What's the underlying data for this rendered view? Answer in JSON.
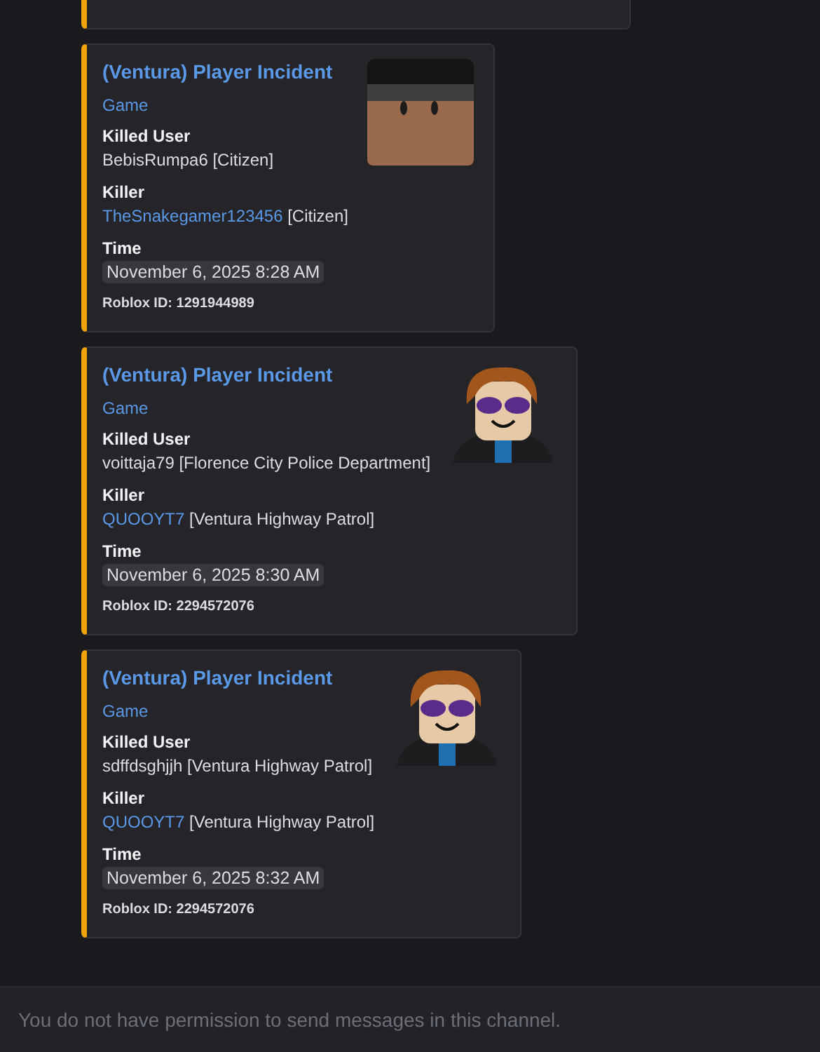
{
  "messages": [
    {
      "kind": "partial"
    },
    {
      "kind": "embed",
      "title": "(Ventura) Player Incident",
      "author": "Game",
      "thumbnail": {
        "kind": "hat"
      },
      "fields": [
        {
          "name": "Killed User",
          "kind": "text",
          "value": "BebisRumpa6 [Citizen]"
        },
        {
          "name": "Killer",
          "kind": "link",
          "link": "TheSnakegamer123456",
          "value": "[Citizen]"
        },
        {
          "name": "Time",
          "kind": "timestamp",
          "value": "November 6, 2025 8:28 AM"
        }
      ],
      "footer": "Roblox ID: 1291944989"
    },
    {
      "kind": "embed",
      "title": "(Ventura) Player Incident",
      "author": "Game",
      "thumbnail": {
        "kind": "hair"
      },
      "fields": [
        {
          "name": "Killed User",
          "kind": "text",
          "value": "voittaja79 [Florence City Police Department]"
        },
        {
          "name": "Killer",
          "kind": "link",
          "link": "QUOOYT7",
          "value": "[Ventura Highway Patrol]"
        },
        {
          "name": "Time",
          "kind": "timestamp",
          "value": "November 6, 2025 8:30 AM"
        }
      ],
      "footer": "Roblox ID: 2294572076"
    },
    {
      "kind": "embed",
      "title": "(Ventura) Player Incident",
      "author": "Game",
      "thumbnail": {
        "kind": "hair"
      },
      "fields": [
        {
          "name": "Killed User",
          "kind": "text",
          "value": "sdffdsghjjh [Ventura Highway Patrol]"
        },
        {
          "name": "Killer",
          "kind": "link",
          "link": "QUOOYT7",
          "value": "[Ventura Highway Patrol]"
        },
        {
          "name": "Time",
          "kind": "timestamp",
          "value": "November 6, 2025 8:32 AM"
        }
      ],
      "footer": "Roblox ID: 2294572076"
    }
  ],
  "composer": {
    "placeholder": "You do not have permission to send messages in this channel."
  }
}
